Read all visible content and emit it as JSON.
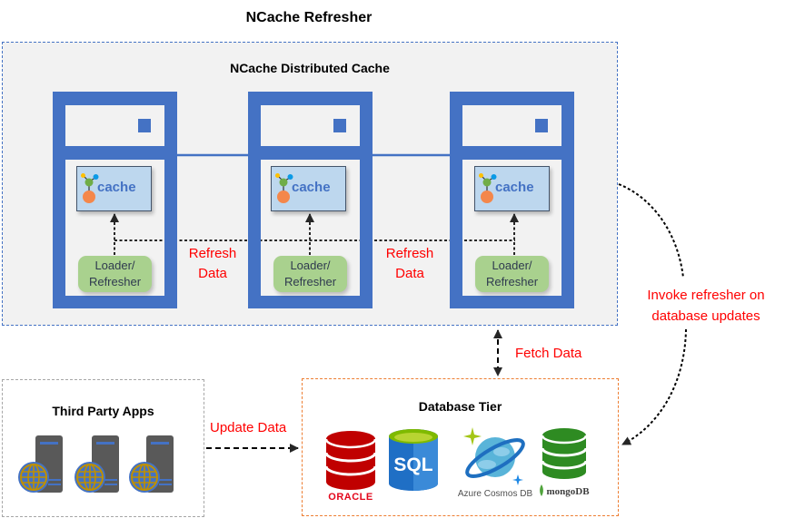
{
  "title": "NCache Refresher",
  "cluster": {
    "title": "NCache Distributed Cache",
    "servers": [
      {
        "cache_label": "cache",
        "loader_line1": "Loader/",
        "loader_line2": "Refresher"
      },
      {
        "cache_label": "cache",
        "loader_line1": "Loader/",
        "loader_line2": "Refresher"
      },
      {
        "cache_label": "cache",
        "loader_line1": "Loader/",
        "loader_line2": "Refresher"
      }
    ],
    "refresh_labels": [
      {
        "line1": "Refresh",
        "line2": "Data"
      },
      {
        "line1": "Refresh",
        "line2": "Data"
      }
    ]
  },
  "flows": {
    "fetch": "Fetch Data",
    "update": "Update Data",
    "invoke_line1": "Invoke refresher on",
    "invoke_line2": "database updates"
  },
  "third_party": {
    "title": "Third Party Apps",
    "icons": [
      "web-server-icon",
      "web-server-icon",
      "web-server-icon"
    ]
  },
  "database_tier": {
    "title": "Database Tier",
    "databases": [
      {
        "icon": "oracle-database-icon",
        "caption": "ORACLE"
      },
      {
        "icon": "sql-server-icon",
        "caption": "SQL"
      },
      {
        "icon": "azure-cosmos-db-icon",
        "caption": "Azure Cosmos DB"
      },
      {
        "icon": "mongodb-icon",
        "caption": "mongoDB"
      }
    ]
  },
  "colors": {
    "server_blue": "#4472C4",
    "cache_fill": "#BDD7EE",
    "loader_green": "#A9D18E",
    "label_red": "#FF0000",
    "db_tier_border": "#ED7D31",
    "third_party_border": "#A6A6A6"
  }
}
